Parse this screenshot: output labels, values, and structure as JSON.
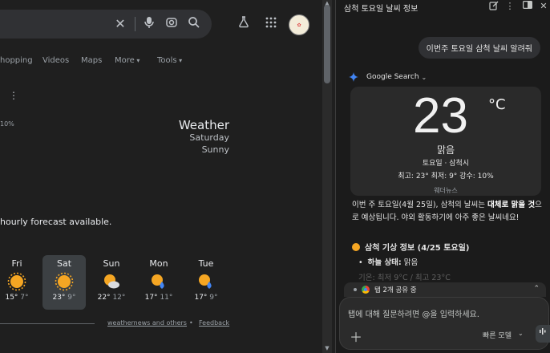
{
  "search": {
    "clear_icon": "close-icon",
    "mic_icon": "mic-icon",
    "lens_icon": "lens-icon",
    "search_icon": "search-icon"
  },
  "topbar": {
    "labs_icon": "flask-icon",
    "apps_icon": "apps-grid-icon",
    "avatar_icon": "avatar"
  },
  "tabs": [
    {
      "label": "hopping"
    },
    {
      "label": "Videos"
    },
    {
      "label": "Maps"
    },
    {
      "label": "More"
    },
    {
      "label": "Tools"
    }
  ],
  "weather": {
    "precip_partial": "10%",
    "title": "Weather",
    "day": "Saturday",
    "condition": "Sunny",
    "hourly_note": "hourly forecast available.",
    "days": [
      {
        "name": "Fri",
        "hi": "15°",
        "lo": "7°",
        "icon": "sun-icon"
      },
      {
        "name": "Sat",
        "hi": "23°",
        "lo": "9°",
        "icon": "sun-icon"
      },
      {
        "name": "Sun",
        "hi": "22°",
        "lo": "12°",
        "icon": "partly-cloudy-icon"
      },
      {
        "name": "Mon",
        "hi": "17°",
        "lo": "11°",
        "icon": "sun-rain-icon"
      },
      {
        "name": "Tue",
        "hi": "17°",
        "lo": "9°",
        "icon": "sun-rain-icon"
      }
    ],
    "source_link": "weathernews and others",
    "separator": "•",
    "feedback_link": "Feedback"
  },
  "panel": {
    "title": "삼척 토요일 날씨 정보",
    "user_message": "이번주 토요일 삼척 날씨 알려줘",
    "source_label": "Google Search",
    "card": {
      "temp": "23",
      "unit": "°C",
      "condition": "맑음",
      "location": "토요일 · 삼척시",
      "stats": "최고: 23° 최저: 9° 강수: 10%",
      "source": "웨더뉴스"
    },
    "answer_pre": "이번 주 토요일(4월 25일), 삼척의 날씨는 ",
    "answer_bold": "대체로 맑을 것",
    "answer_post": "으로 예상됩니다. 야외 활동하기에 아주 좋은 날씨네요!",
    "section_title": "삼척 기상 정보 (4/25 토요일)",
    "bullet_label": "하늘 상태:",
    "bullet_value": " 맑음",
    "bullet_faded": "기온: 최저 9°C / 최고 23°C",
    "share_label": "탭 2개 공유 중",
    "input_placeholder": "탭에 대해 질문하려면 @을 입력하세요.",
    "model_label": "빠른 모델"
  },
  "colors": {
    "sun": "#f5a623",
    "background": "#1f1f1f",
    "panel": "#1b1b1b",
    "accent_blue": "#4285f4"
  }
}
